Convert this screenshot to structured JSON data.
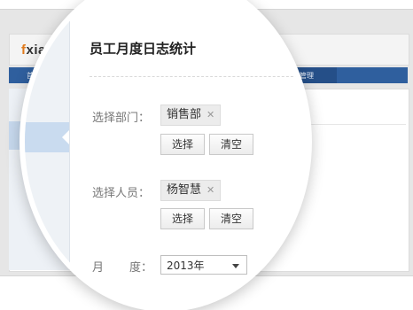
{
  "app": {
    "logo_text": "fxiao",
    "nav": {
      "first_item": "首",
      "active_item": "数据管理"
    }
  },
  "form": {
    "title": "员工月度日志统计",
    "department": {
      "label": "选择部门：",
      "tag": "销售部",
      "select_label": "选择",
      "clear_label": "清空"
    },
    "person": {
      "label": "选择人员：",
      "tag": "杨智慧",
      "select_label": "选择",
      "clear_label": "清空"
    },
    "month": {
      "label_a": "月",
      "label_b": "度：",
      "value": "2013年"
    }
  },
  "icons": {
    "remove_tag": "close-icon",
    "dropdown": "chevron-down-icon"
  },
  "colors": {
    "nav_bar": "#2f5f9e",
    "logo_accent": "#e07a1c",
    "sidebar_active": "#c9dbef"
  }
}
